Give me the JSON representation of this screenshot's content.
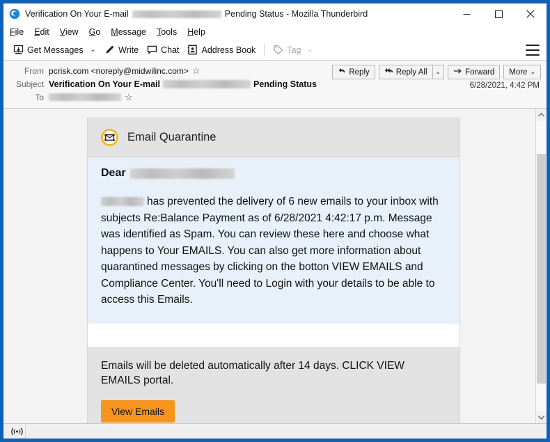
{
  "window": {
    "title_prefix": "Verification On Your E-mail",
    "title_suffix": "Pending Status - Mozilla Thunderbird",
    "app_icon": "thunderbird-icon",
    "minimize_label": "─",
    "maximize_label": "☐",
    "close_label": "✕"
  },
  "menubar": {
    "items": [
      {
        "label": "File",
        "accesskey": "F"
      },
      {
        "label": "Edit",
        "accesskey": "E"
      },
      {
        "label": "View",
        "accesskey": "V"
      },
      {
        "label": "Go",
        "accesskey": "G"
      },
      {
        "label": "Message",
        "accesskey": "M"
      },
      {
        "label": "Tools",
        "accesskey": "T"
      },
      {
        "label": "Help",
        "accesskey": "H"
      }
    ]
  },
  "toolbar": {
    "get_messages": "Get Messages",
    "write": "Write",
    "chat": "Chat",
    "address_book": "Address Book",
    "tag": "Tag",
    "caret": "⌄",
    "menu_icon": "hamburger-menu-icon"
  },
  "header": {
    "from_label": "From",
    "from_value": "pcrisk.com <noreply@midwilinc.com>",
    "subject_label": "Subject",
    "subject_prefix": "Verification On Your E-mail",
    "subject_suffix": "Pending Status",
    "to_label": "To",
    "date": "6/28/2021, 4:42 PM",
    "star_glyph": "☆",
    "actions": {
      "reply": "Reply",
      "reply_all": "Reply All",
      "forward": "Forward",
      "more": "More",
      "caret": "⌄"
    }
  },
  "message": {
    "card_title": "Email Quarantine",
    "card_icon": "quarantine-envelope-icon",
    "greeting_label": "Dear",
    "body_paragraph": "has prevented the delivery of 6 new emails to your inbox with subjects Re:Balance Payment as of 6/28/2021 4:42:17 p.m. Message was identified as Spam. You can review these here and choose what happens to Your EMAILS. You can also get more information about quarantined messages by clicking on the botton VIEW EMAILS and Compliance Center. You'll need to Login with your details to be able to access this Emails.",
    "footer_text": "Emails will be deleted automatically after 14 days. CLICK VIEW EMAILS portal.",
    "view_button": "View Emails"
  },
  "statusbar": {
    "icon": "broadcast-icon"
  },
  "colors": {
    "window_border": "#0e61b8",
    "accent_orange": "#f7941d",
    "card_head_bg": "#e2e2e2",
    "card_body_bg": "#e8f1fa",
    "pane_bg": "#f3f3f3"
  }
}
